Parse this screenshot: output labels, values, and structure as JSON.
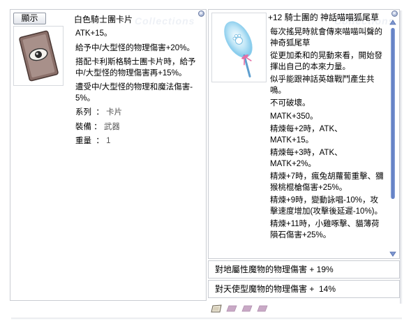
{
  "left_window": {
    "show_button": "顯示",
    "title": "白色騎士團卡片",
    "watermark": "Collections",
    "card_image": "white-knight-card-icon",
    "description": [
      "ATK+15。",
      "給予中/大型怪的物理傷害+20%。",
      "搭配卡利斯格騎士團卡片時，給予中/大型怪的物理傷害再+15%。",
      "遭受中/大型怪的物理和魔法傷害- 5%。"
    ],
    "meta": [
      {
        "label": "系列",
        "sep": "：",
        "value": "卡片"
      },
      {
        "label": "裝備",
        "sep": "：",
        "value": "武器"
      },
      {
        "label": "重量",
        "sep": "：",
        "value": "1"
      }
    ]
  },
  "right_window": {
    "title": "+12 騎士團的 神話喵喵狐尾草",
    "watermark": "Collections",
    "item_image": "cat-foxtail-wand-icon",
    "description": [
      "每次搖晃時就會傳來喵喵叫聲的神奇狐尾草",
      "從更加柔和的晃動來看，開始發揮出自己的本來力量。",
      "似乎能跟神話英雄戰鬥產生共鳴。",
      "不可破壞。",
      "MATK+350。",
      "精煉每+2時，ATK、MATK+15。",
      "精煉每+3時，ATK、MATK+2%。",
      "精煉+7時，瘋兔胡蘿蔔重擊、獼猴桃棍槍傷害+25%。",
      "精煉+9時，變動詠唱-10%，攻擊速度增加(攻擊後延遲-10%)。",
      "精煉+11時，小雞啄擊、貓薄荷隕石傷害+25%。"
    ]
  },
  "options": [
    "對地屬性魔物的物理傷害 + 19%",
    "對天使型魔物的物理傷害 +  14%"
  ],
  "slots": [
    "card-slot-filled-icon",
    "card-slot-empty-icon",
    "card-slot-empty-icon",
    "card-slot-empty-icon"
  ],
  "colors": {
    "border": "#c9ccd2",
    "scroll_thumb": "#5a78c0",
    "slot_filled": "#ebe6d6",
    "slot_empty": "#c9a9c6"
  }
}
